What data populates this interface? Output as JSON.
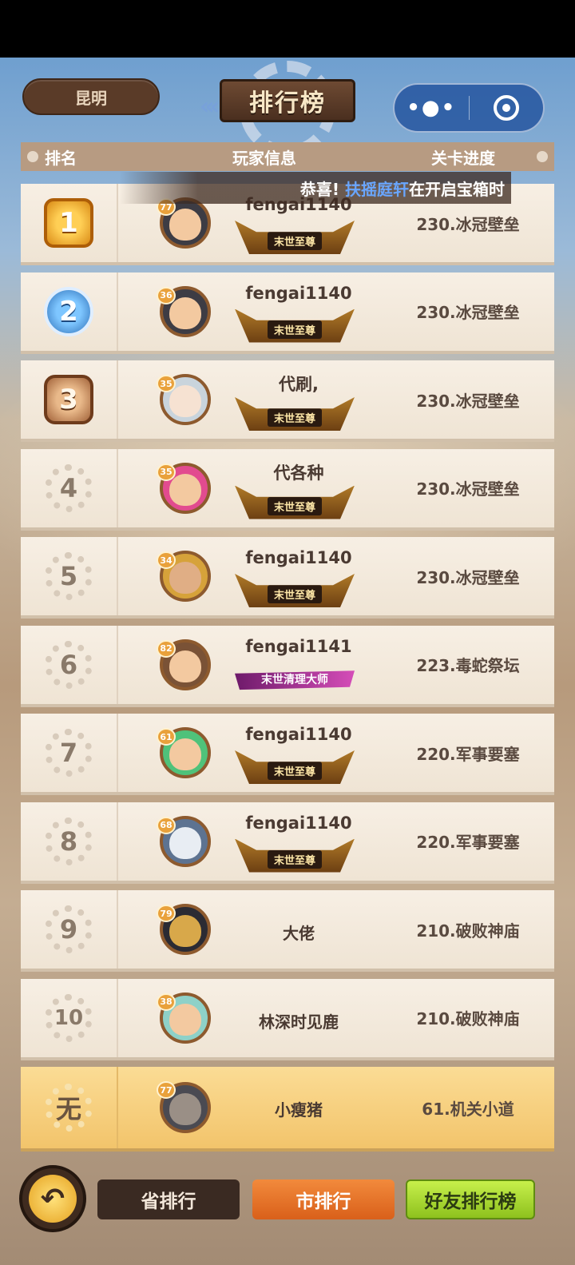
{
  "header": {
    "city": "昆明",
    "title": "排行榜",
    "menu_icon": "more-dots-icon",
    "close_icon": "target-close-icon"
  },
  "table": {
    "col_rank": "排名",
    "col_player": "玩家信息",
    "col_progress": "关卡进度"
  },
  "marquee": {
    "prefix": "恭喜!",
    "name": "扶摇庭轩",
    "suffix": "在开启宝箱时"
  },
  "rows": [
    {
      "rank": "1",
      "level": "77",
      "name": "fengai1140",
      "title": "末世至尊",
      "progress": "230.冰冠壁垒"
    },
    {
      "rank": "2",
      "level": "36",
      "name": "fengai1140",
      "title": "末世至尊",
      "progress": "230.冰冠壁垒"
    },
    {
      "rank": "3",
      "level": "35",
      "name": "代刷,",
      "title": "末世至尊",
      "progress": "230.冰冠壁垒"
    },
    {
      "rank": "4",
      "level": "35",
      "name": "代各种",
      "title": "末世至尊",
      "progress": "230.冰冠壁垒"
    },
    {
      "rank": "5",
      "level": "34",
      "name": "fengai1140",
      "title": "末世至尊",
      "progress": "230.冰冠壁垒"
    },
    {
      "rank": "6",
      "level": "82",
      "name": "fengai1141",
      "title": "末世清理大师",
      "progress": "223.毒蛇祭坛"
    },
    {
      "rank": "7",
      "level": "61",
      "name": "fengai1140",
      "title": "末世至尊",
      "progress": "220.军事要塞"
    },
    {
      "rank": "8",
      "level": "68",
      "name": "fengai1140",
      "title": "末世至尊",
      "progress": "220.军事要塞"
    },
    {
      "rank": "9",
      "level": "79",
      "name": "大佬",
      "progress": "210.破败神庙"
    },
    {
      "rank": "10",
      "level": "38",
      "name": "林深时见鹿",
      "progress": "210.破败神庙"
    }
  ],
  "me": {
    "rank": "无",
    "level": "77",
    "name": "小瘦猪",
    "progress": "61.机关小道"
  },
  "bottom": {
    "back_icon": "back-arrow-icon",
    "tab_province": "省排行",
    "tab_city": "市排行",
    "tab_friends": "好友排行榜"
  },
  "colors": {
    "row_bg": "#f7efe4",
    "mine_bg": "#f2c46b",
    "active_tab": "#e8762a",
    "friends_tab": "#a8d933"
  }
}
